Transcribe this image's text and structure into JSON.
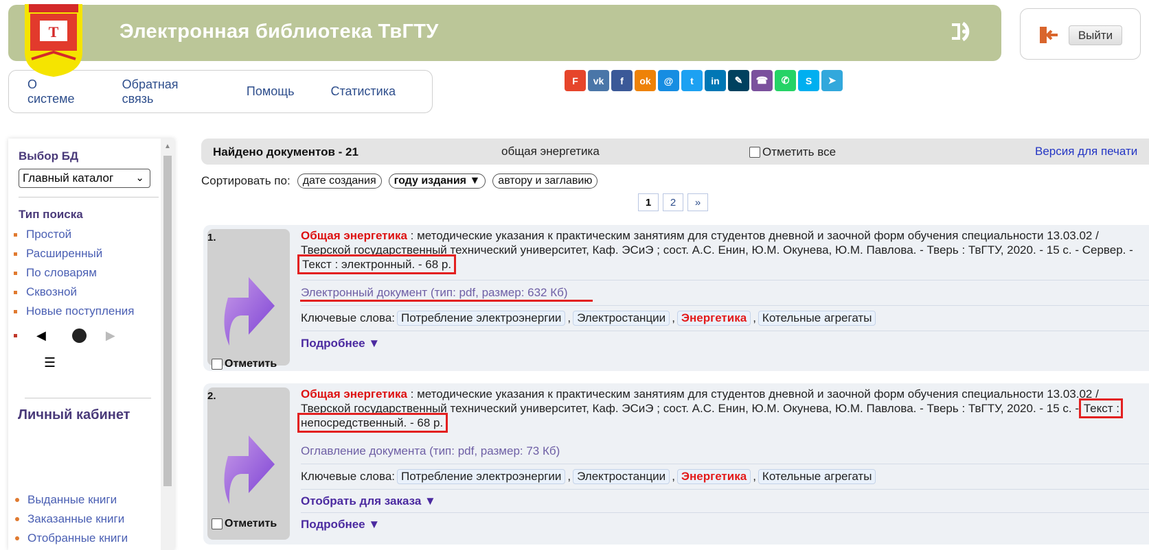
{
  "header": {
    "title": "Электронная библиотека ТвГТУ",
    "logout_label": "Выйти",
    "colors": {
      "bar": "#bbc698",
      "accent_red": "#e32020"
    }
  },
  "topnav": [
    "О системе",
    "Обратная связь",
    "Помощь",
    "Статистика"
  ],
  "social": [
    {
      "name": "flipboard-icon",
      "glyph": "F",
      "color": "#e6452b"
    },
    {
      "name": "vk-icon",
      "glyph": "vk",
      "color": "#4a76a8"
    },
    {
      "name": "facebook-icon",
      "glyph": "f",
      "color": "#3b5998"
    },
    {
      "name": "odnoklassniki-icon",
      "glyph": "ok",
      "color": "#ee8208"
    },
    {
      "name": "moimir-icon",
      "glyph": "@",
      "color": "#168de2"
    },
    {
      "name": "twitter-icon",
      "glyph": "t",
      "color": "#1da1f2"
    },
    {
      "name": "linkedin-icon",
      "glyph": "in",
      "color": "#0077b5"
    },
    {
      "name": "livejournal-icon",
      "glyph": "✎",
      "color": "#00415f"
    },
    {
      "name": "viber-icon",
      "glyph": "☎",
      "color": "#7b519d"
    },
    {
      "name": "whatsapp-icon",
      "glyph": "✆",
      "color": "#25d366"
    },
    {
      "name": "skype-icon",
      "glyph": "S",
      "color": "#00aff0"
    },
    {
      "name": "telegram-icon",
      "glyph": "➤",
      "color": "#32a8dc"
    }
  ],
  "sidebar": {
    "db_heading": "Выбор БД",
    "db_selected": "Главный каталог",
    "search_heading": "Тип поиска",
    "search_types": [
      "Простой",
      "Расширенный",
      "По словарям",
      "Сквозной",
      "Новые поступления"
    ],
    "cabinet_heading": "Личный кабинет",
    "cabinet_items": [
      "Выданные книги",
      "Заказанные книги",
      "Отобранные книги"
    ]
  },
  "results": {
    "found": "Найдено документов - 21",
    "query": "общая энергетика",
    "mark_all": "Отметить все",
    "print_version": "Версия для печати",
    "sort_label": "Сортировать по:",
    "sort_options": [
      "дате создания",
      "году издания ▼",
      "автору и заглавию"
    ],
    "pages": [
      "1",
      "2",
      "»"
    ]
  },
  "documents": [
    {
      "num": "1.",
      "title": "Общая энергетика",
      "desc": " : методические указания к практическим занятиям для студентов дневной и заочной форм обучения специальности 13.03.02 / Тверской государственный технический университет, Каф. ЭСиЭ ; сост. А.С. Енин, Ю.М. Окунева, Ю.М. Павлова. - Тверь : ТвГТУ, 2020. - 15 с. - Сервер. - ",
      "boxed": "Текст : электронный. - 68 р.",
      "file_link": "Электронный документ (тип: pdf, размер: 632 Кб)",
      "kw_label": "Ключевые слова:",
      "keywords": [
        "Потребление электроэнергии",
        "Электростанции",
        "Энергетика",
        "Котельные агрегаты"
      ],
      "order": "",
      "more": "Подробнее ▼",
      "mark": "Отметить"
    },
    {
      "num": "2.",
      "title": "Общая энергетика",
      "desc": " : методические указания к практическим занятиям для студентов дневной и заочной форм обучения специальности 13.03.02 / Тверской государственный технический университет, Каф. ЭСиЭ ; сост. А.С. Енин, Ю.М. Окунева, Ю.М. Павлова. - Тверь : ТвГТУ, 2020. - 15 с. - ",
      "boxed": "Текст : непосредственный. - 68 р.",
      "file_link": "Оглавление документа (тип: pdf, размер: 73 Кб)",
      "kw_label": "Ключевые слова:",
      "keywords": [
        "Потребление электроэнергии",
        "Электростанции",
        "Энергетика",
        "Котельные агрегаты"
      ],
      "order": "Отобрать для заказа ▼",
      "more": "Подробнее ▼",
      "mark": "Отметить"
    }
  ]
}
